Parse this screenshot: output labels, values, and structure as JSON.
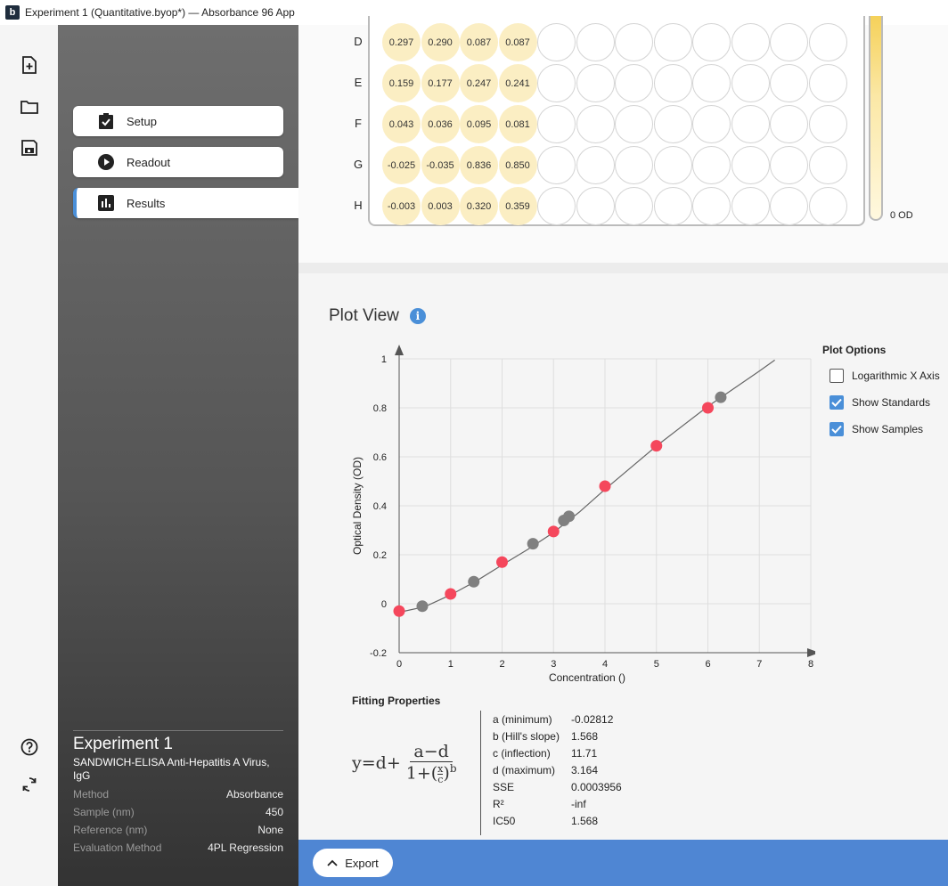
{
  "window": {
    "title": "Experiment 1 (Quantitative.byop*) — Absorbance 96 App",
    "logo": "b"
  },
  "nav": [
    {
      "label": "Setup",
      "icon": "clipboard-check-icon",
      "active": false
    },
    {
      "label": "Readout",
      "icon": "play-circle-icon",
      "active": false
    },
    {
      "label": "Results",
      "icon": "bar-chart-icon",
      "active": true
    }
  ],
  "experiment": {
    "title": "Experiment 1",
    "subtitle": "SANDWICH-ELISA Anti-Hepatitis A Virus, IgG",
    "fields": [
      {
        "key": "Method",
        "value": "Absorbance"
      },
      {
        "key": "Sample (nm)",
        "value": "450"
      },
      {
        "key": "Reference (nm)",
        "value": "None"
      },
      {
        "key": "Evaluation Method",
        "value": "4PL Regression"
      }
    ]
  },
  "plate": {
    "rows": [
      {
        "label": "D",
        "values": [
          "0.297",
          "0.290",
          "0.087",
          "0.087"
        ]
      },
      {
        "label": "E",
        "values": [
          "0.159",
          "0.177",
          "0.247",
          "0.241"
        ]
      },
      {
        "label": "F",
        "values": [
          "0.043",
          "0.036",
          "0.095",
          "0.081"
        ]
      },
      {
        "label": "G",
        "values": [
          "-0.025",
          "-0.035",
          "0.836",
          "0.850"
        ]
      },
      {
        "label": "H",
        "values": [
          "-0.003",
          "0.003",
          "0.320",
          "0.359"
        ]
      }
    ],
    "columns": 12,
    "od_label": "0 OD",
    "well_color": "#fbeec3"
  },
  "plot_view": {
    "title": "Plot View"
  },
  "chart_data": {
    "type": "scatter",
    "xlabel": "Concentration ()",
    "ylabel": "Optical Density (OD)",
    "xlim": [
      0,
      8
    ],
    "ylim": [
      -0.2,
      1
    ],
    "x_ticks": [
      "0",
      "1",
      "2",
      "3",
      "4",
      "5",
      "6",
      "7",
      "8"
    ],
    "y_ticks": [
      "-0.2",
      "0",
      "0.2",
      "0.4",
      "0.6",
      "0.8",
      "1"
    ],
    "grid": true,
    "series": [
      {
        "color": "#f5475c",
        "points": [
          [
            0,
            -0.03
          ],
          [
            1,
            0.04
          ],
          [
            2,
            0.17
          ],
          [
            3,
            0.295
          ],
          [
            4,
            0.48
          ],
          [
            5,
            0.645
          ],
          [
            6,
            0.8
          ]
        ]
      },
      {
        "color": "#808080",
        "points": [
          [
            0.45,
            -0.01
          ],
          [
            1.45,
            0.09
          ],
          [
            2.6,
            0.245
          ],
          [
            3.2,
            0.34
          ],
          [
            3.3,
            0.357
          ],
          [
            6.25,
            0.843
          ]
        ]
      }
    ],
    "fit_line": {
      "color": "#666666",
      "points": [
        [
          0,
          -0.035
        ],
        [
          0.5,
          -0.012
        ],
        [
          1,
          0.036
        ],
        [
          1.5,
          0.093
        ],
        [
          2,
          0.158
        ],
        [
          2.5,
          0.222
        ],
        [
          3,
          0.291
        ],
        [
          3.5,
          0.374
        ],
        [
          4,
          0.467
        ],
        [
          5,
          0.644
        ],
        [
          6,
          0.806
        ],
        [
          7,
          0.95
        ],
        [
          7.3,
          0.995
        ]
      ]
    }
  },
  "plot_options": {
    "title": "Plot Options",
    "items": [
      {
        "label": "Logarithmic X Axis",
        "checked": false
      },
      {
        "label": "Show Standards",
        "checked": true
      },
      {
        "label": "Show Samples",
        "checked": true
      }
    ]
  },
  "fitting": {
    "title": "Fitting Properties",
    "formula": {
      "lhs": "y=d+",
      "num": "a−d",
      "den_pre": "1+(",
      "den_frac_num": "x",
      "den_frac_den": "c",
      "den_post": ")",
      "exp": "b"
    },
    "rows": [
      {
        "key": "a (minimum)",
        "value": "-0.02812"
      },
      {
        "key": "b (Hill's slope)",
        "value": "1.568"
      },
      {
        "key": "c (inflection)",
        "value": "11.71"
      },
      {
        "key": "d (maximum)",
        "value": "3.164"
      },
      {
        "key": "SSE",
        "value": "0.0003956"
      },
      {
        "key": "R²",
        "value": "-inf"
      },
      {
        "key": "IC50",
        "value": "1.568"
      }
    ]
  },
  "export": {
    "label": "Export"
  }
}
